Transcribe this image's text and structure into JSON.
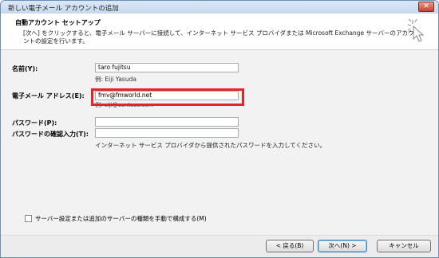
{
  "window": {
    "title": "新しい電子メール アカウントの追加",
    "close_label": "✕"
  },
  "header": {
    "title": "自動アカウント セットアップ",
    "description": "[次へ] をクリックすると、電子メール サーバーに接続して、インターネット サービス プロバイダまたは Microsoft Exchange サーバーのアカウントの設定を行います。"
  },
  "form": {
    "name_label": "名前(Y):",
    "name_value": "taro fujitsu",
    "name_example": "例: Eiji Yasuda",
    "email_label": "電子メール アドレス(E):",
    "email_value": "fmv@fmworld.net",
    "email_example": "例: eiji@contoso.com",
    "password_label": "パスワード(P):",
    "password_value": "",
    "password_confirm_label": "パスワードの確認入力(T):",
    "password_confirm_value": "",
    "password_hint": "インターネット サービス プロバイダから提供されたパスワードを入力してください。",
    "manual_config_label": "サーバー設定または追加のサーバーの種類を手動で構成する(M)"
  },
  "footer": {
    "back_label": "< 戻る(B)",
    "next_label": "次へ(N) >",
    "cancel_label": "キャンセル"
  },
  "colors": {
    "highlight": "#e5242a",
    "title_bar": "#c7d9ee"
  }
}
